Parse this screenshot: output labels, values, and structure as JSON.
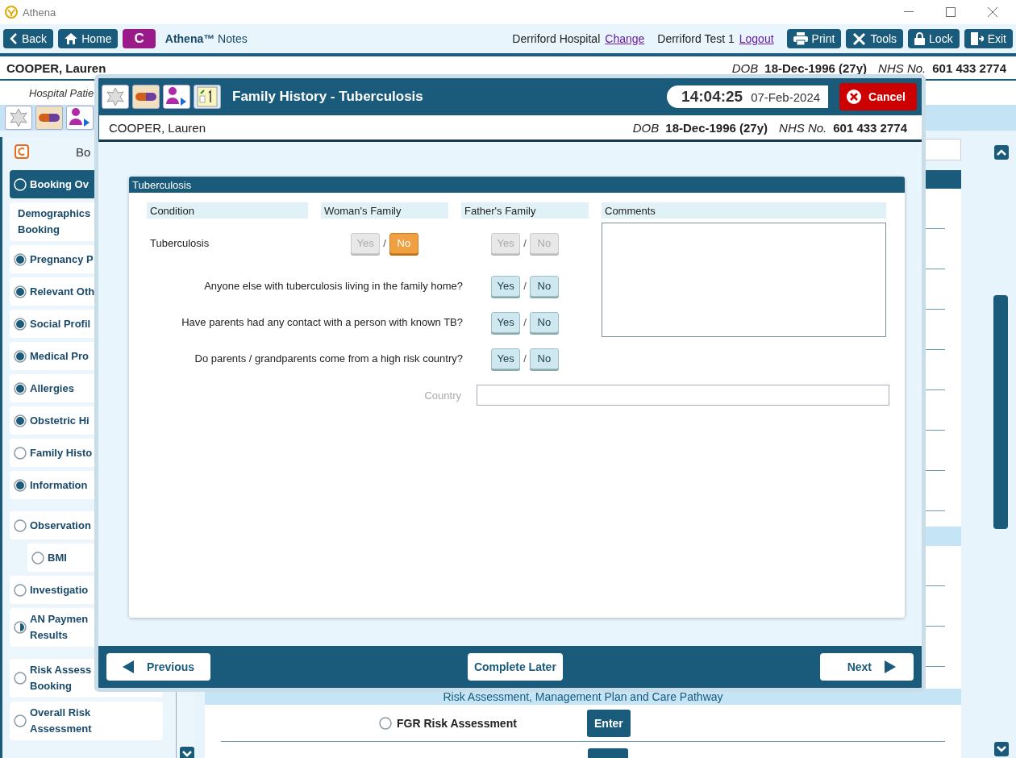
{
  "window": {
    "title": "Athena"
  },
  "toolbar": {
    "left_buttons": [
      {
        "label": "Back",
        "kind": "back"
      },
      {
        "label": "Home",
        "kind": "home"
      },
      {
        "label": "C",
        "kind": "letter"
      }
    ],
    "app_name": "**Athena™** Notes",
    "location": "Derriford Hospital",
    "location_link": "Change",
    "user": "Derriford Test 1",
    "user_link": "Logout",
    "right_buttons": [
      {
        "label": "Print",
        "kind": "print"
      },
      {
        "label": "Tools",
        "kind": "tools"
      },
      {
        "label": "Lock",
        "kind": "lock"
      },
      {
        "label": "Exit",
        "kind": "exit"
      }
    ]
  },
  "patient": {
    "name": "COOPER, Lauren",
    "dob_label": "DOB",
    "dob": "18-Dec-1996 (27y)",
    "nhs_label": "NHS No.",
    "nhs": "601 433 2774"
  },
  "background": {
    "subtitle": "Hospital Patie",
    "section_label": "Bo",
    "sidebar_groups": [
      {
        "items": [
          {
            "lines": [
              "Booking Ov"
            ],
            "kind": "empty",
            "selected": true
          },
          {
            "lines": [
              "Demographics",
              "Booking"
            ],
            "kind": "none",
            "selected": false
          },
          {
            "lines": [
              "Pregnancy P"
            ],
            "kind": "complete",
            "selected": false
          },
          {
            "lines": [
              "Relevant Oth"
            ],
            "kind": "complete",
            "selected": false
          },
          {
            "lines": [
              "Social Profil"
            ],
            "kind": "complete",
            "selected": false
          },
          {
            "lines": [
              "Medical Pro"
            ],
            "kind": "complete",
            "selected": false
          },
          {
            "lines": [
              "Allergies"
            ],
            "kind": "complete",
            "selected": false
          },
          {
            "lines": [
              "Obstetric Hi"
            ],
            "kind": "complete",
            "selected": false
          },
          {
            "lines": [
              "Family Histo"
            ],
            "kind": "empty",
            "selected": false
          },
          {
            "lines": [
              "Information"
            ],
            "kind": "complete",
            "selected": false
          }
        ]
      },
      {
        "items": [
          {
            "lines": [
              "Observation"
            ],
            "kind": "empty",
            "selected": false
          },
          {
            "lines": [
              "BMI"
            ],
            "kind": "empty",
            "selected": false,
            "sub": true
          },
          {
            "lines": [
              "Investigatio"
            ],
            "kind": "empty",
            "selected": false
          },
          {
            "lines": [
              "AN Paymen",
              "Results"
            ],
            "kind": "partial",
            "selected": false
          }
        ]
      },
      {
        "items": [
          {
            "lines": [
              "Risk Assess",
              "Booking"
            ],
            "kind": "empty",
            "selected": false
          },
          {
            "lines": [
              "Overall Risk",
              "Assessment"
            ],
            "kind": "empty",
            "selected": false
          }
        ]
      }
    ],
    "band_title": "Risk Assessment, Management Plan and Care Pathway",
    "rows": [
      {
        "label": "FGR Risk Assessment",
        "button": "Enter"
      }
    ]
  },
  "dialog": {
    "title": "Family History - Tuberculosis",
    "time": "14:04:25",
    "date": "07-Feb-2024",
    "cancel": "Cancel",
    "patient": {
      "name": "COOPER, Lauren",
      "dob_label": "DOB",
      "dob": "18-Dec-1996 (27y)",
      "nhs_label": "NHS No.",
      "nhs": "601 433 2774"
    },
    "panel_title": "Tuberculosis",
    "columns": [
      "Condition",
      "Woman's Family",
      "Father's Family",
      "Comments"
    ],
    "rows": [
      {
        "label": "Tuberculosis",
        "kind": "condition",
        "woman": [
          {
            "label": "Yes",
            "selected": false,
            "disabled": true
          },
          {
            "label": "No",
            "selected": true,
            "disabled": false
          }
        ],
        "father": [
          {
            "label": "Yes",
            "selected": false,
            "disabled": true
          },
          {
            "label": "No",
            "selected": false,
            "disabled": true
          }
        ]
      },
      {
        "label": "Anyone else with tuberculosis living in the family home?",
        "kind": "question",
        "father": [
          {
            "label": "Yes",
            "selected": false,
            "disabled": false
          },
          {
            "label": "No",
            "selected": false,
            "disabled": false
          }
        ]
      },
      {
        "label": "Have parents had any contact with a person with known TB?",
        "kind": "question",
        "father": [
          {
            "label": "Yes",
            "selected": false,
            "disabled": false
          },
          {
            "label": "No",
            "selected": false,
            "disabled": false
          }
        ]
      },
      {
        "label": "Do parents / grandparents come from a high risk country?",
        "kind": "question",
        "father": [
          {
            "label": "Yes",
            "selected": false,
            "disabled": false
          },
          {
            "label": "No",
            "selected": false,
            "disabled": false
          }
        ]
      }
    ],
    "separator": "/",
    "country": {
      "label": "Country",
      "disabled": true
    },
    "footer": {
      "previous": "Previous",
      "complete_later": "Complete Later",
      "next": "Next"
    }
  }
}
